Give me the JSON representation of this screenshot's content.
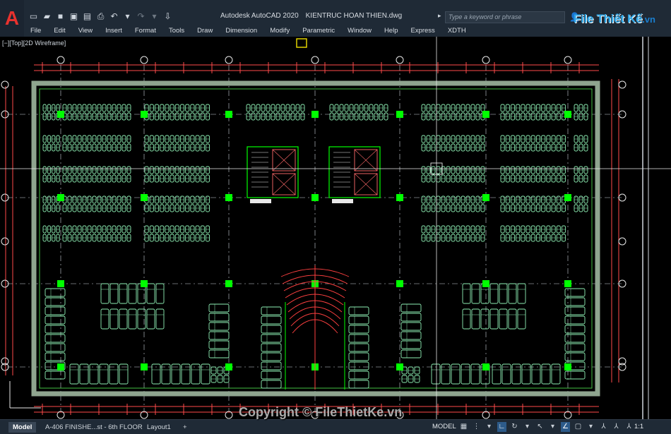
{
  "titlebar": {
    "app": "Autodesk AutoCAD 2020",
    "file": "KIENTRUC HOAN THIEN.dwg",
    "search_placeholder": "Type a keyword or phrase",
    "brand": "File Thiết Kế",
    "brand_suffix": ".vn"
  },
  "menu": [
    "File",
    "Edit",
    "View",
    "Insert",
    "Format",
    "Tools",
    "Draw",
    "Dimension",
    "Modify",
    "Parametric",
    "Window",
    "Help",
    "Express",
    "XDTH"
  ],
  "viewport": {
    "label": "[−][Top][2D Wireframe]"
  },
  "status": {
    "tabs": [
      "Model",
      "A-406 FINISHE...st - 6th FLOOR",
      "Layout1"
    ],
    "add_tab": "+",
    "mode": "MODEL",
    "scale": "1:1"
  },
  "watermark": "Copyright © FileThietKe.vn",
  "colors": {
    "drawing_bg": "#000000",
    "parking": "#8ef0b4",
    "column": "#00ff00",
    "wall": "#8fa58f",
    "dimension": "#ff4a4a",
    "accent": "#2fa8e8"
  }
}
